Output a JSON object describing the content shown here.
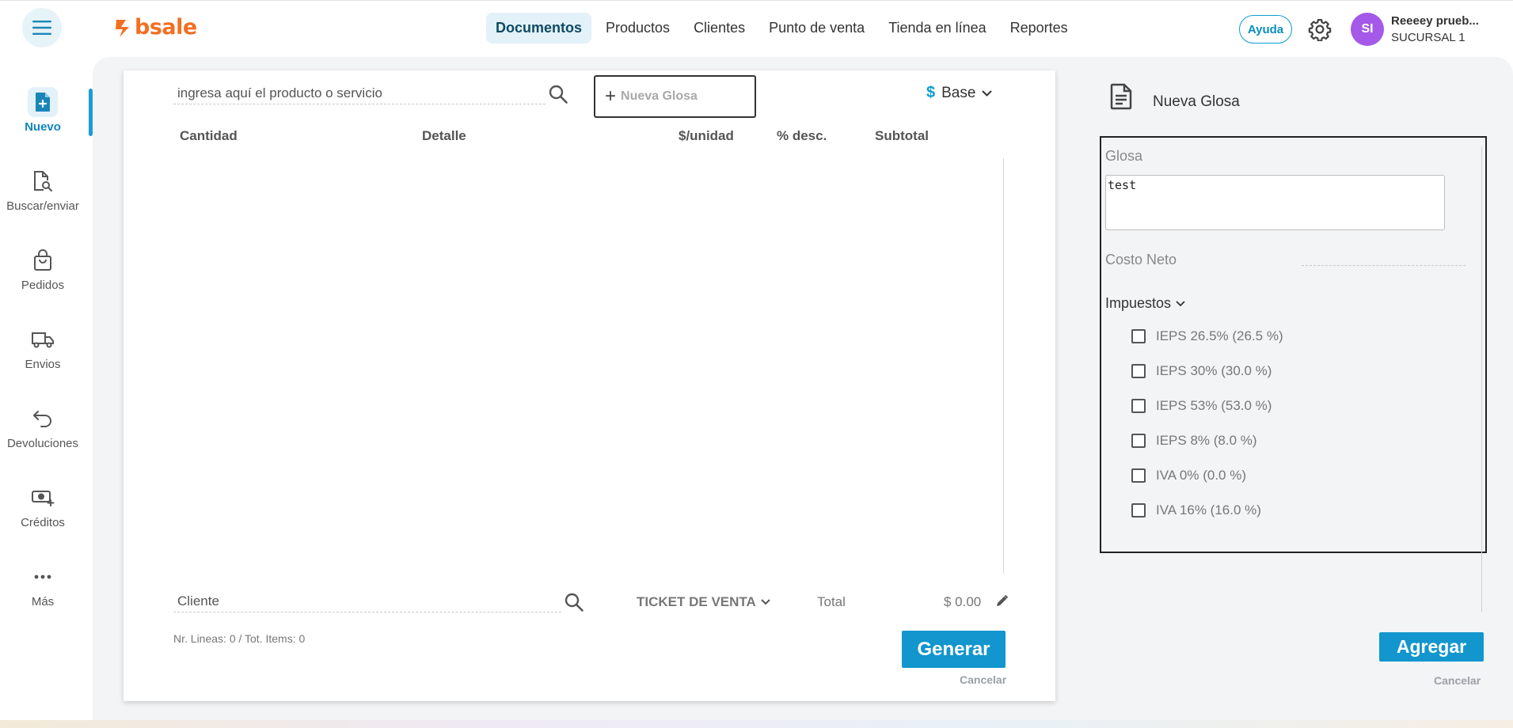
{
  "brand": {
    "logo_text": "bsale",
    "color": "#f36f21"
  },
  "topnav": {
    "items": [
      {
        "label": "Documentos",
        "active": true
      },
      {
        "label": "Productos"
      },
      {
        "label": "Clientes"
      },
      {
        "label": "Punto de venta"
      },
      {
        "label": "Tienda en línea"
      },
      {
        "label": "Reportes"
      }
    ],
    "help_label": "Ayuda"
  },
  "user": {
    "initials": "SI",
    "name": "Reeeey prueb...",
    "branch": "SUCURSAL 1",
    "avatar_color": "#a459e8"
  },
  "sidebar": {
    "items": [
      {
        "label": "Nuevo",
        "icon": "new-document-icon",
        "active": true
      },
      {
        "label": "Buscar/enviar",
        "icon": "document-search-icon"
      },
      {
        "label": "Pedidos",
        "icon": "shopping-bag-icon"
      },
      {
        "label": "Envios",
        "icon": "truck-icon"
      },
      {
        "label": "Devoluciones",
        "icon": "return-arrow-icon"
      },
      {
        "label": "Créditos",
        "icon": "money-plus-icon"
      },
      {
        "label": "Más",
        "icon": "more-dots-icon"
      }
    ]
  },
  "document": {
    "product_search_placeholder": "ingresa aquí el producto o servicio",
    "nueva_glosa_label": "Nueva Glosa",
    "currency_symbol": "$",
    "currency_label": "Base",
    "columns": [
      "Cantidad",
      "Detalle",
      "$/unidad",
      "% desc.",
      "Subtotal"
    ],
    "client_placeholder": "Cliente",
    "doc_type": "TICKET DE VENTA",
    "total_label": "Total",
    "total_value": "$ 0.00",
    "lines_info": "Nr. Lineas: 0 / Tot. Items: 0",
    "generate_label": "Generar",
    "cancel_label": "Cancelar"
  },
  "glosa_panel": {
    "title": "Nueva Glosa",
    "glosa_label": "Glosa",
    "glosa_value": "test",
    "costo_label": "Costo Neto",
    "taxes_label": "Impuestos",
    "taxes": [
      {
        "label": "IEPS 26.5% (26.5 %)",
        "checked": false
      },
      {
        "label": "IEPS 30% (30.0 %)",
        "checked": false
      },
      {
        "label": "IEPS 53% (53.0 %)",
        "checked": false
      },
      {
        "label": "IEPS 8% (8.0 %)",
        "checked": false
      },
      {
        "label": "IVA 0% (0.0 %)",
        "checked": false
      },
      {
        "label": "IVA 16% (16.0 %)",
        "checked": false
      }
    ],
    "add_label": "Agregar",
    "cancel_label": "Cancelar"
  },
  "colors": {
    "accent": "#1296cd",
    "active_nav_bg": "#e3f1f8",
    "panel_bg": "#f3f4f6"
  }
}
